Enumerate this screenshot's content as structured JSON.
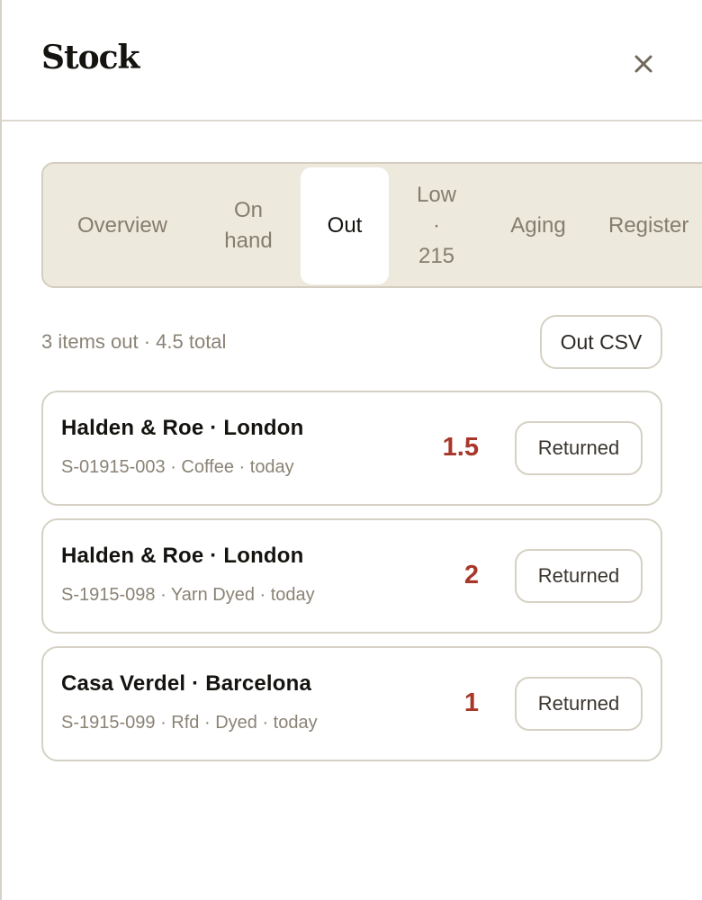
{
  "header": {
    "title": "Stock",
    "close_icon": "close-icon"
  },
  "tabs": [
    {
      "label": "Overview",
      "active": false
    },
    {
      "label": "On\nhand",
      "active": false
    },
    {
      "label": "Out",
      "active": true
    },
    {
      "label": "Low\n·\n215",
      "active": false
    },
    {
      "label": "Aging",
      "active": false
    },
    {
      "label": "Register",
      "active": false
    }
  ],
  "summary": {
    "text": "3 items out · 4.5 total",
    "csv_label": "Out CSV"
  },
  "items": [
    {
      "name": "Halden & Roe · London",
      "meta": "S-01915-003 · Coffee · today",
      "qty": "1.5",
      "action_label": "Returned"
    },
    {
      "name": "Halden & Roe · London",
      "meta": "S-1915-098 · Yarn Dyed · today",
      "qty": "2",
      "action_label": "Returned"
    },
    {
      "name": "Casa Verdel · Barcelona",
      "meta": "S-1915-099 · Rfd · Dyed · today",
      "qty": "1",
      "action_label": "Returned"
    }
  ],
  "colors": {
    "accent_qty": "#a8372a",
    "tab_bar_bg": "#ede9dd",
    "muted_text": "#8a8375"
  }
}
